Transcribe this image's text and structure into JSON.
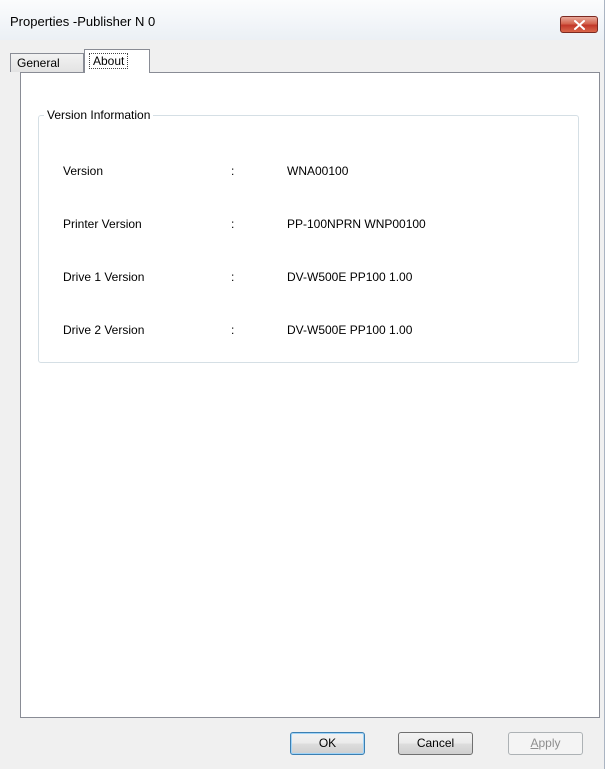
{
  "window": {
    "title": "Properties  -Publisher N 0"
  },
  "tabs": [
    {
      "label": "General",
      "selected": false
    },
    {
      "label": "About",
      "selected": true
    }
  ],
  "version_group": {
    "title": "Version Information",
    "rows": [
      {
        "label": "Version",
        "separator": ":",
        "value": "WNA00100"
      },
      {
        "label": "Printer Version",
        "separator": ":",
        "value": "PP-100NPRN WNP00100"
      },
      {
        "label": "Drive 1 Version",
        "separator": ":",
        "value": "DV-W500E PP100  1.00"
      },
      {
        "label": "Drive 2 Version",
        "separator": ":",
        "value": "DV-W500E PP100  1.00"
      }
    ]
  },
  "buttons": {
    "ok": "OK",
    "cancel": "Cancel",
    "apply_first": "A",
    "apply_rest": "pply",
    "apply_enabled": false
  },
  "colors": {
    "close_button": "#c2382a",
    "dialog_background": "#f0f0f0",
    "panel_background": "#ffffff"
  }
}
